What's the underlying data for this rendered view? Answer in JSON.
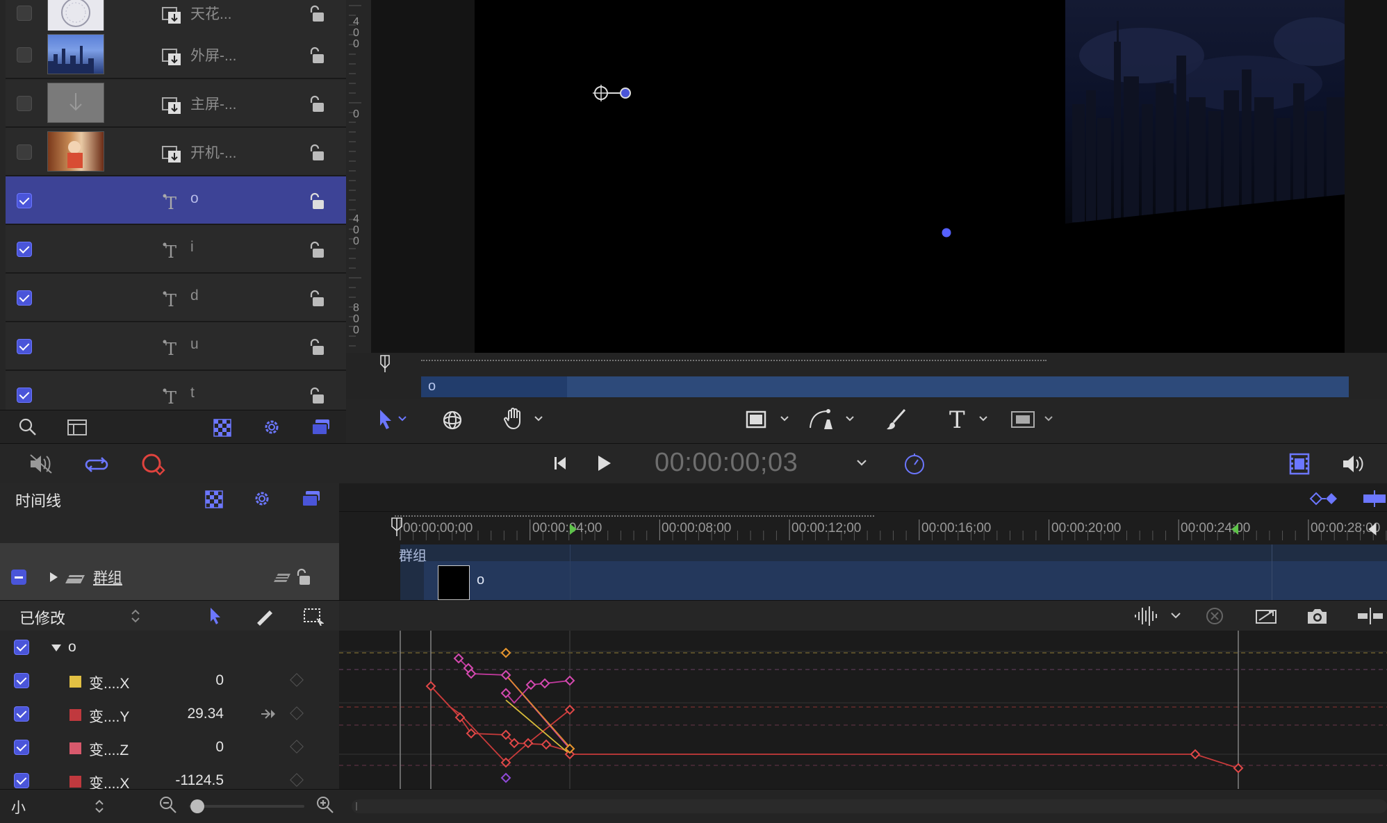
{
  "layers": [
    {
      "name": "天花...",
      "checked": false,
      "type": "media",
      "thumb": "clock"
    },
    {
      "name": "外屏-...",
      "checked": false,
      "type": "media",
      "thumb": "city"
    },
    {
      "name": "主屏-...",
      "checked": false,
      "type": "media",
      "thumb": "placeholder"
    },
    {
      "name": "开机-...",
      "checked": false,
      "type": "media",
      "thumb": "photo"
    },
    {
      "name": "o",
      "checked": true,
      "type": "text",
      "selected": true
    },
    {
      "name": "i",
      "checked": true,
      "type": "text"
    },
    {
      "name": "d",
      "checked": true,
      "type": "text"
    },
    {
      "name": "u",
      "checked": true,
      "type": "text"
    },
    {
      "name": "t",
      "checked": true,
      "type": "text"
    }
  ],
  "ruler_labels": [
    "4",
    "0",
    "0",
    "0",
    "4",
    "0",
    "0",
    "8",
    "0",
    "0"
  ],
  "mini_timeline": {
    "bar_label": "o"
  },
  "transport": {
    "timecode": "00:00:00;03"
  },
  "timeline": {
    "title": "时间线",
    "ruler_ticks": [
      "00:00:00;00",
      "00:00:04;00",
      "00:00:08;00",
      "00:00:12;00",
      "00:00:16;00",
      "00:00:20;00",
      "00:00:24;00",
      "00:00:28;00"
    ],
    "group_label": "群组",
    "group_name": "群组",
    "clip_label": "o"
  },
  "graph_editor": {
    "filter": "已修改",
    "root": "o",
    "params": [
      {
        "name": "变....X",
        "value": "0",
        "color": "#e2c043"
      },
      {
        "name": "变....Y",
        "value": "29.34",
        "color": "#c0393e"
      },
      {
        "name": "变....Z",
        "value": "0",
        "color": "#d8596c"
      },
      {
        "name": "变....X",
        "value": "-1124.5",
        "color": "#c0393e"
      }
    ]
  },
  "footer": {
    "size_label": "小"
  }
}
